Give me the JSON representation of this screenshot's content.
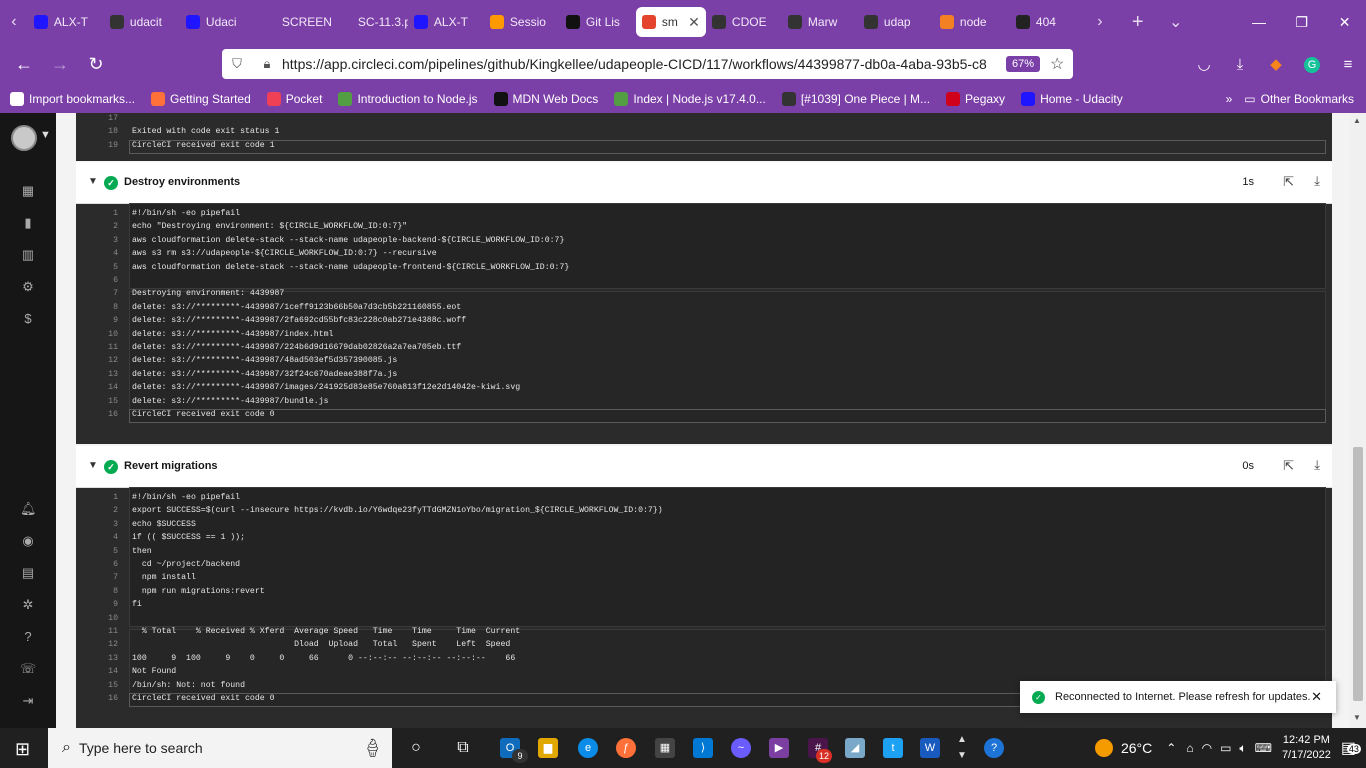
{
  "browser": {
    "tabs": [
      {
        "label": "ALX-T",
        "icon": "udacity-icon",
        "color": "#2015ff"
      },
      {
        "label": "udacit",
        "icon": "github-icon",
        "color": "#333333"
      },
      {
        "label": "Udaci",
        "icon": "udacity-icon",
        "color": "#2015ff"
      },
      {
        "label": "SCREENSH",
        "icon": "blank-icon",
        "color": "#7b3fa8"
      },
      {
        "label": "SC-11.3.p",
        "icon": "blank-icon",
        "color": "#7b3fa8"
      },
      {
        "label": "ALX-T",
        "icon": "udacity-icon",
        "color": "#2015ff"
      },
      {
        "label": "Sessio",
        "icon": "aws-icon",
        "color": "#ff9900"
      },
      {
        "label": "Git Lis",
        "icon": "github-icon",
        "color": "#111111"
      },
      {
        "label": "sm",
        "icon": "circleci-icon",
        "color": "#e4432d",
        "active": true
      },
      {
        "label": "CDOE",
        "icon": "github-icon",
        "color": "#333333"
      },
      {
        "label": "Marw",
        "icon": "github-icon",
        "color": "#333333"
      },
      {
        "label": "udap",
        "icon": "github-icon",
        "color": "#333333"
      },
      {
        "label": "node",
        "icon": "stackoverflow-icon",
        "color": "#f48024"
      },
      {
        "label": "404",
        "icon": "kvdb-icon",
        "color": "#222222"
      }
    ],
    "url": "https://app.circleci.com/pipelines/github/Kingkellee/udapeople-CICD/117/workflows/44399877-db0a-4aba-93b5-c8",
    "zoom": "67%",
    "bookmarks": [
      {
        "label": "Import bookmarks...",
        "color": "#ffffff"
      },
      {
        "label": "Getting Started",
        "color": "#ff7139"
      },
      {
        "label": "Pocket",
        "color": "#ef4056"
      },
      {
        "label": "Introduction to Node.js",
        "color": "#539e43"
      },
      {
        "label": "MDN Web Docs",
        "color": "#111111"
      },
      {
        "label": "Index | Node.js v17.4.0...",
        "color": "#539e43"
      },
      {
        "label": "[#1039] One Piece | M...",
        "color": "#333333"
      },
      {
        "label": "Pegaxy",
        "color": "#d0021b"
      },
      {
        "label": "Home - Udacity",
        "color": "#2015ff"
      }
    ],
    "other_bookmarks": "Other Bookmarks"
  },
  "steps": [
    {
      "title": "",
      "duration": "",
      "lines": [
        {
          "n": "17",
          "t": ""
        },
        {
          "n": "18",
          "t": "Exited with code exit status 1"
        },
        {
          "n": "19",
          "t": "CircleCI received exit code 1",
          "exit": true
        }
      ]
    },
    {
      "title": "Destroy environments",
      "duration": "1s",
      "lines": [
        {
          "n": "1",
          "t": "#!/bin/sh -eo pipefail"
        },
        {
          "n": "2",
          "t": "echo \"Destroying environment: ${CIRCLE_WORKFLOW_ID:0:7}\""
        },
        {
          "n": "3",
          "t": "aws cloudformation delete-stack --stack-name udapeople-backend-${CIRCLE_WORKFLOW_ID:0:7}"
        },
        {
          "n": "4",
          "t": "aws s3 rm s3://udapeople-${CIRCLE_WORKFLOW_ID:0:7} --recursive"
        },
        {
          "n": "5",
          "t": "aws cloudformation delete-stack --stack-name udapeople-frontend-${CIRCLE_WORKFLOW_ID:0:7}"
        },
        {
          "n": "6",
          "t": ""
        },
        {
          "n": "7",
          "t": "Destroying environment: 4439987"
        },
        {
          "n": "8",
          "t": "delete: s3://*********-4439987/1ceff9123b66b50a7d3cb5b221160855.eot"
        },
        {
          "n": "9",
          "t": "delete: s3://*********-4439987/2fa692cd55bfc83c228c0ab271e4388c.woff"
        },
        {
          "n": "10",
          "t": "delete: s3://*********-4439987/index.html"
        },
        {
          "n": "11",
          "t": "delete: s3://*********-4439987/224b6d9d16679dab02826a2a7ea705eb.ttf"
        },
        {
          "n": "12",
          "t": "delete: s3://*********-4439987/48ad503ef5d357390085.js"
        },
        {
          "n": "13",
          "t": "delete: s3://*********-4439987/32f24c670adeae388f7a.js"
        },
        {
          "n": "14",
          "t": "delete: s3://*********-4439987/images/241925d83e85e760a813f12e2d14042e-kiwi.svg"
        },
        {
          "n": "15",
          "t": "delete: s3://*********-4439987/bundle.js"
        },
        {
          "n": "16",
          "t": "CircleCI received exit code 0",
          "exit": true
        }
      ]
    },
    {
      "title": "Revert migrations",
      "duration": "0s",
      "lines": [
        {
          "n": "1",
          "t": "#!/bin/sh -eo pipefail"
        },
        {
          "n": "2",
          "t": "export SUCCESS=$(curl --insecure https://kvdb.io/Y6wdqe23fyTTdGMZN1oYbo/migration_${CIRCLE_WORKFLOW_ID:0:7})"
        },
        {
          "n": "3",
          "t": "echo $SUCCESS"
        },
        {
          "n": "4",
          "t": "if (( $SUCCESS == 1 ));"
        },
        {
          "n": "5",
          "t": "then"
        },
        {
          "n": "6",
          "t": "  cd ~/project/backend"
        },
        {
          "n": "7",
          "t": "  npm install"
        },
        {
          "n": "8",
          "t": "  npm run migrations:revert"
        },
        {
          "n": "9",
          "t": "fi"
        },
        {
          "n": "10",
          "t": ""
        },
        {
          "n": "11",
          "t": "  % Total    % Received % Xferd  Average Speed   Time    Time     Time  Current"
        },
        {
          "n": "12",
          "t": "                                 Dload  Upload   Total   Spent    Left  Speed"
        },
        {
          "n": "13",
          "t": "100     9  100     9    0     0     66      0 --:--:-- --:--:-- --:--:--    66"
        },
        {
          "n": "14",
          "t": "Not Found"
        },
        {
          "n": "15",
          "t": "/bin/sh: Not: not found"
        },
        {
          "n": "16",
          "t": "CircleCI received exit code 0",
          "exit": true
        }
      ]
    }
  ],
  "toast": {
    "text": "Reconnected to Internet. Please refresh for updates."
  },
  "taskbar": {
    "search_placeholder": "Type here to search",
    "weather": "26°C",
    "time": "12:42 PM",
    "date": "7/17/2022",
    "notification_count": "43",
    "badge_outlook": "9",
    "badge_slack": "12"
  },
  "colors": {
    "accent": "#7b3fa8",
    "success": "#04aa51",
    "terminal": "#2b2b2b"
  }
}
